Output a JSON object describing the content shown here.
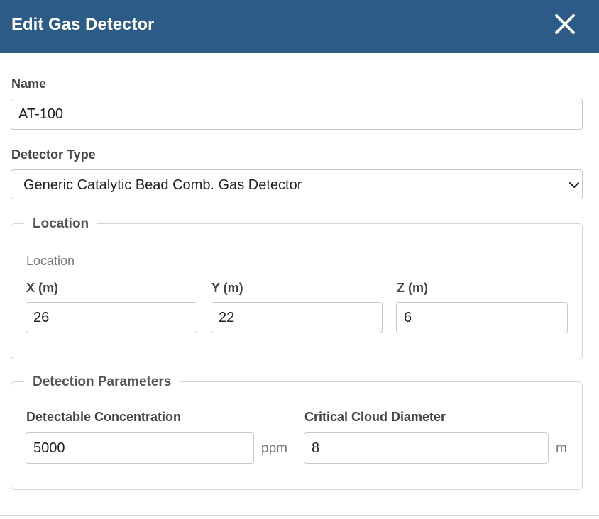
{
  "dialog": {
    "title": "Edit Gas Detector"
  },
  "name": {
    "label": "Name",
    "value": "AT-100"
  },
  "detector_type": {
    "label": "Detector Type",
    "selected": "Generic Catalytic Bead Comb. Gas Detector"
  },
  "location": {
    "legend": "Location",
    "sublabel": "Location",
    "x": {
      "label": "X (m)",
      "value": "26"
    },
    "y": {
      "label": "Y (m)",
      "value": "22"
    },
    "z": {
      "label": "Z (m)",
      "value": "6"
    }
  },
  "detection": {
    "legend": "Detection Parameters",
    "concentration": {
      "label": "Detectable Concentration",
      "value": "5000",
      "unit": "ppm"
    },
    "cloud_diameter": {
      "label": "Critical Cloud Diameter",
      "value": "8",
      "unit": "m"
    }
  },
  "theme": {
    "header_bg": "#2d5b87",
    "header_text": "#ffffff"
  },
  "icons": {
    "close": "close-icon",
    "dropdown": "chevron-down-icon"
  }
}
